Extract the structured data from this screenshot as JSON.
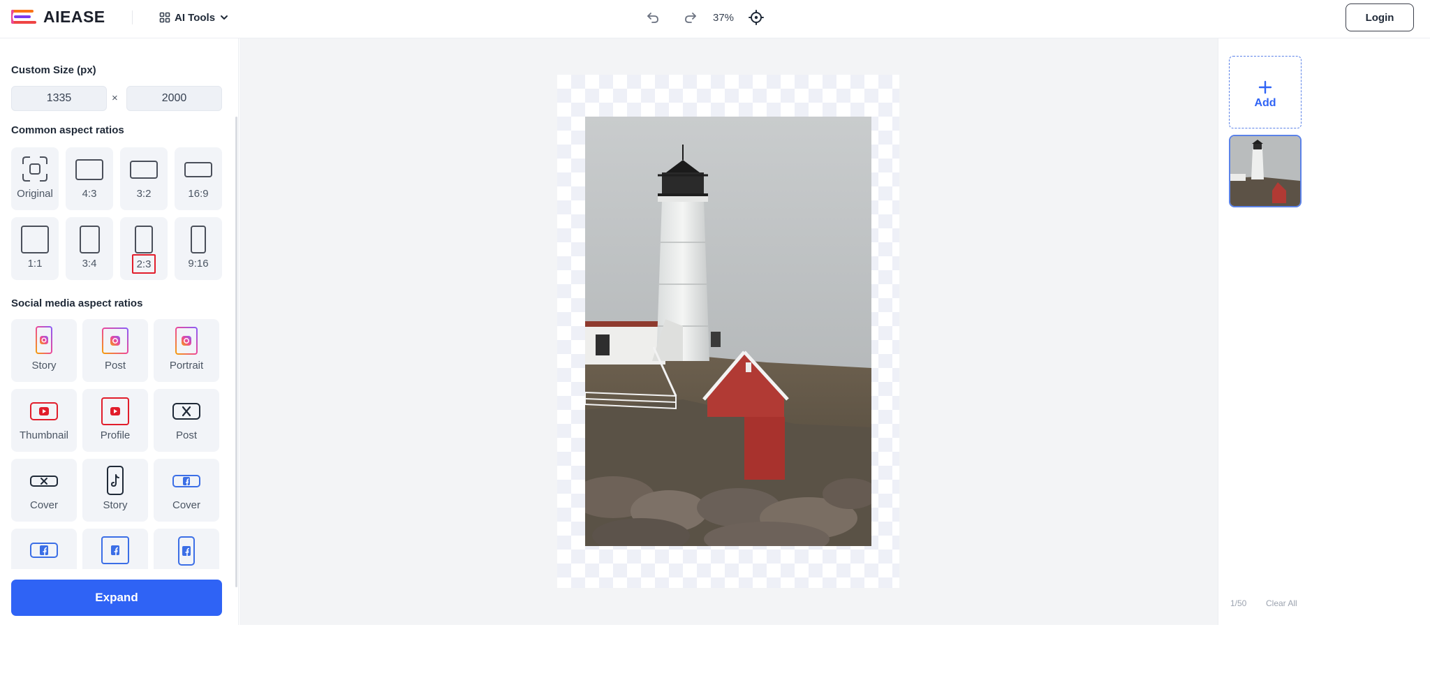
{
  "header": {
    "logo_text": "AIEASE",
    "ai_tools_label": "AI Tools",
    "zoom": "37%",
    "login_label": "Login"
  },
  "sidebar": {
    "custom_size_title": "Custom Size (px)",
    "width_value": "1335",
    "height_value": "2000",
    "times": "×",
    "common_title": "Common aspect ratios",
    "common_ratios": [
      {
        "label": "Original"
      },
      {
        "label": "4:3"
      },
      {
        "label": "3:2"
      },
      {
        "label": "16:9"
      },
      {
        "label": "1:1"
      },
      {
        "label": "3:4"
      },
      {
        "label": "2:3",
        "selected": true
      },
      {
        "label": "9:16"
      }
    ],
    "social_title": "Social media aspect ratios",
    "social_ratios": [
      {
        "label": "Story",
        "icon": "instagram-icon"
      },
      {
        "label": "Post",
        "icon": "instagram-icon"
      },
      {
        "label": "Portrait",
        "icon": "instagram-icon"
      },
      {
        "label": "Thumbnail",
        "icon": "youtube-icon"
      },
      {
        "label": "Profile",
        "icon": "youtube-icon"
      },
      {
        "label": "Post",
        "icon": "x-icon"
      },
      {
        "label": "Cover",
        "icon": "x-icon"
      },
      {
        "label": "Story",
        "icon": "tiktok-icon"
      },
      {
        "label": "Cover",
        "icon": "facebook-icon"
      },
      {
        "label": "",
        "icon": "facebook-icon"
      },
      {
        "label": "",
        "icon": "facebook-icon"
      },
      {
        "label": "",
        "icon": "facebook-icon"
      }
    ],
    "expand_label": "Expand"
  },
  "right_panel": {
    "add_label": "Add",
    "count": "1/50",
    "clear_label": "Clear All"
  },
  "colors": {
    "accent": "#2f63f5",
    "selected_border": "#e11d2b"
  }
}
